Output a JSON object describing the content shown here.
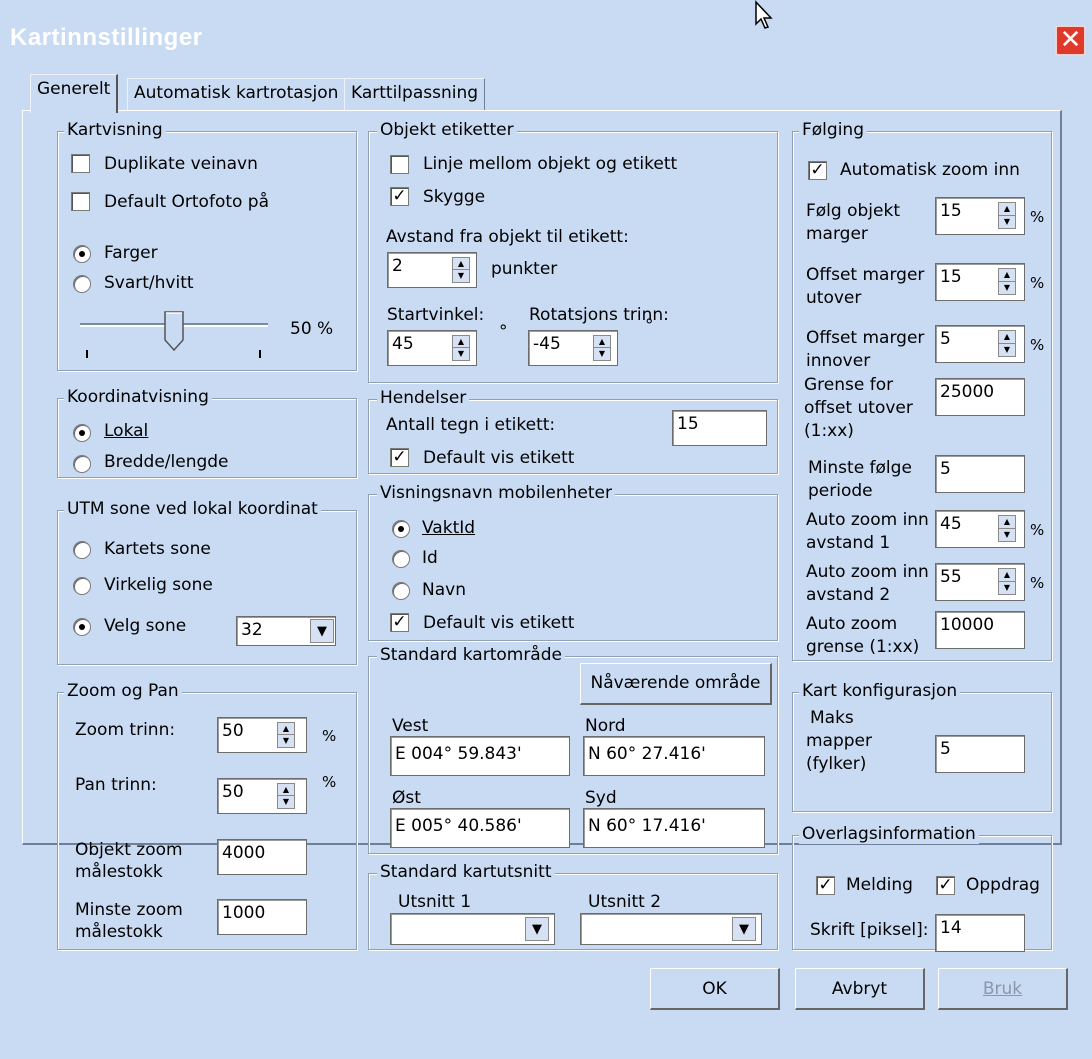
{
  "window": {
    "title": "Kartinnstillinger",
    "close_icon": "close-icon"
  },
  "tabs": [
    "Generelt",
    "Automatisk kartrotasjon",
    "Karttilpassning"
  ],
  "kartvisning": {
    "label": "Kartvisning",
    "duplikate": {
      "label": "Duplikate veinavn",
      "checked": false
    },
    "ortofoto": {
      "label": "Default Ortofoto på",
      "checked": false
    },
    "farger": "Farger",
    "svart": "Svart/hvitt",
    "slider_value": "50 %",
    "slider_level": 0.5
  },
  "koordinat": {
    "label": "Koordinatvisning",
    "lokal": "Lokal",
    "bredde": "Bredde/lengde"
  },
  "utm": {
    "label": "UTM sone ved lokal koordinat",
    "kartets": "Kartets sone",
    "virkelig": "Virkelig sone",
    "velg": "Velg sone",
    "sone_value": "32"
  },
  "zoom": {
    "label": "Zoom og Pan",
    "zoom_trinn_label": "Zoom trinn:",
    "zoom_trinn": "50",
    "pan_trinn_label": "Pan trinn:",
    "pan_trinn": "50",
    "pct": "%",
    "objekt_label1": "Objekt zoom",
    "objekt_label2": "målestokk",
    "objekt_value": "4000",
    "minste_label1": "Minste zoom",
    "minste_label2": "målestokk",
    "minste_value": "1000"
  },
  "objekt": {
    "label": "Objekt etiketter",
    "linje": {
      "label": "Linje mellom objekt og etikett",
      "checked": false
    },
    "skygge": {
      "label": "Skygge",
      "checked": true
    },
    "avstand_label": "Avstand fra objekt til etikett:",
    "avstand_value": "2",
    "punkter": "punkter",
    "startvinkel_label": "Startvinkel:",
    "startvinkel": "45",
    "rotasjon_label": "Rotatsjons trinn:",
    "rotasjon": "-45",
    "deg": "°"
  },
  "hendelser": {
    "label": "Hendelser",
    "antall_label": "Antall tegn i etikett:",
    "antall_value": "15",
    "default_vis": "Default vis etikett"
  },
  "visningsnavn": {
    "label": "Visningsnavn mobilenheter",
    "vaktid": "VaktId",
    "id": "Id",
    "navn": "Navn",
    "default_vis": "Default vis etikett"
  },
  "kartomrade": {
    "label": "Standard kartområde",
    "button": "Nåværende område",
    "vest_label": "Vest",
    "vest": "E 004° 59.843'",
    "nord_label": "Nord",
    "nord": "N 60° 27.416'",
    "ost_label": "Øst",
    "ost": "E 005° 40.586'",
    "syd_label": "Syd",
    "syd": "N 60° 17.416'"
  },
  "kartutsnitt": {
    "label": "Standard kartutsnitt",
    "u1": "Utsnitt 1",
    "u2": "Utsnitt 2"
  },
  "folging": {
    "label": "Følging",
    "auto_zoom_inn": "Automatisk zoom inn",
    "folg_objekt_1": "Følg objekt",
    "folg_objekt_2": "marger",
    "folg_objekt": "15",
    "offset_ut_1": "Offset marger",
    "offset_ut_2": "utover",
    "offset_ut": "15",
    "offset_inn_1": "Offset marger",
    "offset_inn_2": "innover",
    "offset_inn": "5",
    "grense_1": "Grense for",
    "grense_2": "offset utover",
    "grense_3": "(1:xx)",
    "grense": "25000",
    "minste_1": "Minste følge",
    "minste_2": "periode",
    "minste": "5",
    "az1_1": "Auto zoom inn",
    "az1_2": "avstand 1",
    "az1": "45",
    "az2_1": "Auto zoom inn",
    "az2_2": "avstand 2",
    "az2": "55",
    "azg_1": "Auto zoom",
    "azg_2": "grense (1:xx)",
    "azg": "10000",
    "pct": "%"
  },
  "kartkonf": {
    "label": "Kart konfigurasjon",
    "maks_1": "Maks",
    "maks_2": "mapper",
    "maks_3": "(fylker)",
    "maks": "5"
  },
  "overlag": {
    "label": "Overlagsinformation",
    "melding": "Melding",
    "oppdrag": "Oppdrag",
    "skrift_label": "Skrift [piksel]:",
    "skrift": "14"
  },
  "buttons": {
    "ok": "OK",
    "avbryt": "Avbryt",
    "bruk": "Bruk"
  }
}
